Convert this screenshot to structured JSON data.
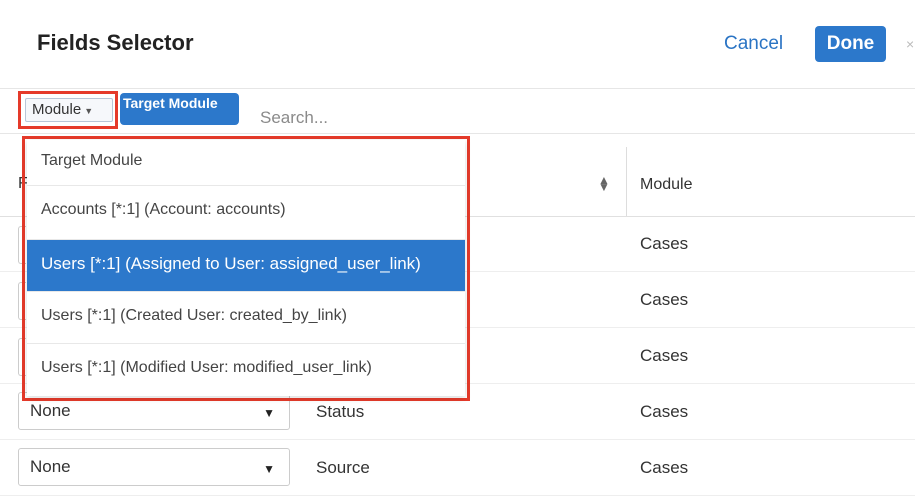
{
  "header": {
    "title": "Fields Selector",
    "cancel_label": "Cancel",
    "done_label": "Done",
    "close_glyph": "×"
  },
  "filter": {
    "module_label": "Module",
    "target_pill": "Target Module",
    "search_placeholder": "Search..."
  },
  "table": {
    "head_partial": "F",
    "module_header": "Module",
    "rows": [
      {
        "module": "Cases"
      },
      {
        "module": "Cases"
      },
      {
        "module": "Cases"
      },
      {
        "select": "None",
        "field": "Status",
        "module": "Cases"
      },
      {
        "select": "None",
        "field": "Source",
        "module": "Cases"
      }
    ]
  },
  "dropdown": {
    "items": [
      "Target Module",
      "Accounts [*:1] (Account: accounts)",
      "Users [*:1] (Assigned to User: assigned_user_link)",
      "Users [*:1] (Created User: created_by_link)",
      "Users [*:1] (Modified User: modified_user_link)"
    ],
    "selected_index": 2
  },
  "colors": {
    "accent": "#2c78cb",
    "highlight": "#e53a2a"
  },
  "icons": {
    "caret": "caret-down-icon",
    "sort": "sort-icon",
    "close": "close-icon"
  }
}
